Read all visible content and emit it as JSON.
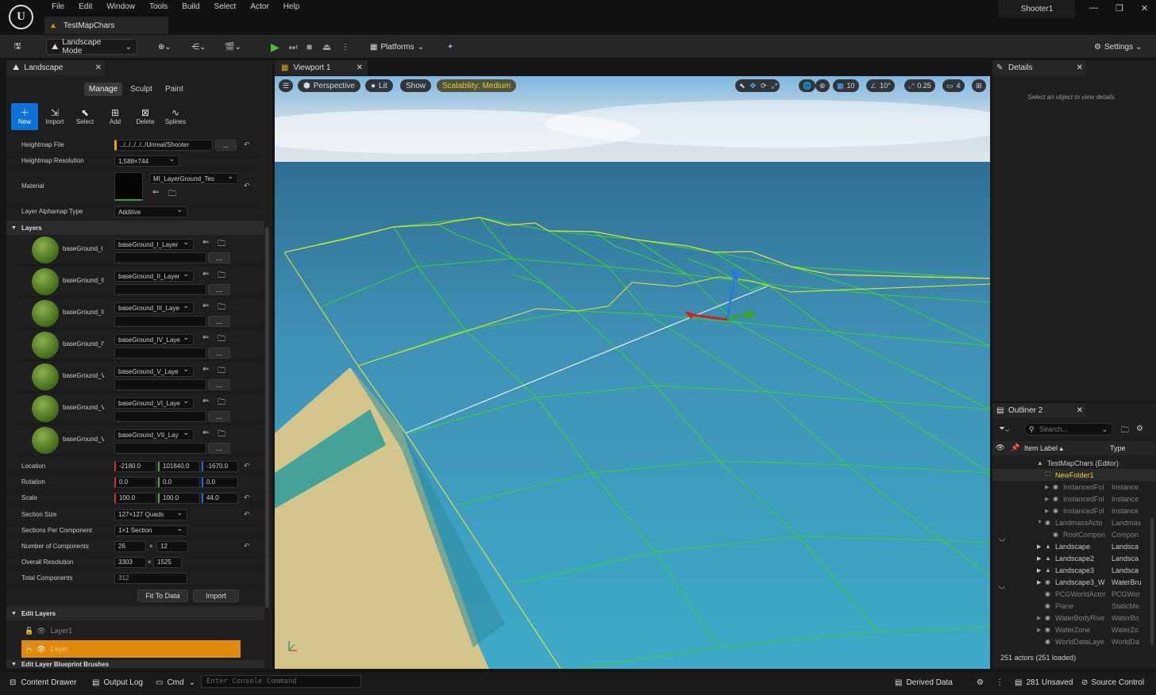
{
  "app": {
    "logo": "U",
    "menu": [
      "File",
      "Edit",
      "Window",
      "Tools",
      "Build",
      "Select",
      "Actor",
      "Help"
    ],
    "map_tab": "TestMapChars",
    "project": "Shooter1"
  },
  "toolbar": {
    "mode": "Landscape Mode",
    "platforms": "Platforms",
    "settings": "Settings"
  },
  "landscape": {
    "tab": "Landscape",
    "modes": [
      "Manage",
      "Sculpt",
      "Paint"
    ],
    "tools": [
      {
        "label": "New",
        "icon": "plus-icon"
      },
      {
        "label": "Import",
        "icon": "import-icon"
      },
      {
        "label": "Select",
        "icon": "select-icon"
      },
      {
        "label": "Add",
        "icon": "add-icon"
      },
      {
        "label": "Delete",
        "icon": "delete-icon"
      },
      {
        "label": "Splines",
        "icon": "splines-icon"
      }
    ],
    "heightmap_file_label": "Heightmap File",
    "heightmap_file": "../../../../../Unreal/Shooter",
    "heightmap_res_label": "Heightmap Resolution",
    "heightmap_res": "1,588×744",
    "material_label": "Material",
    "material": "MI_LayerGround_Tes",
    "alphamap_label": "Layer Alphamap Type",
    "alphamap": "Additive",
    "layers_header": "Layers",
    "layers": [
      {
        "name": "baseGround_I",
        "asset": "baseGround_I_Layer"
      },
      {
        "name": "baseGround_II",
        "asset": "baseGround_II_Layer"
      },
      {
        "name": "baseGround_II",
        "asset": "baseGround_III_Laye"
      },
      {
        "name": "baseGround_IV",
        "asset": "baseGround_IV_Laye"
      },
      {
        "name": "baseGround_V",
        "asset": "baseGround_V_Laye"
      },
      {
        "name": "baseGround_V",
        "asset": "baseGround_VI_Laye"
      },
      {
        "name": "baseGround_V",
        "asset": "baseGround_VII_Lay"
      }
    ],
    "location_label": "Location",
    "location": [
      "-2180.0",
      "101840.0",
      "-1670.0"
    ],
    "rotation_label": "Rotation",
    "rotation": [
      "0.0",
      "0.0",
      "0.0"
    ],
    "scale_label": "Scale",
    "scale": [
      "100.0",
      "100.0",
      "44.0"
    ],
    "section_size_label": "Section Size",
    "section_size": "127×127 Quads",
    "spc_label": "Sections Per Component",
    "spc": "1×1 Section",
    "ncomp_label": "Number of Components",
    "ncomp": [
      "26",
      "12"
    ],
    "ores_label": "Overall Resolution",
    "ores": [
      "3303",
      "1525"
    ],
    "total_label": "Total Components",
    "total": "312",
    "fit_btn": "Fit To Data",
    "import_btn": "Import",
    "edit_layers_header": "Edit Layers",
    "edit_layers": [
      "Layer1",
      "Layer"
    ],
    "blueprint_header": "Edit Layer Blueprint Brushes",
    "browse": "...",
    "times": "×"
  },
  "viewport": {
    "tab": "Viewport 1",
    "perspective": "Perspective",
    "lit": "Lit",
    "show": "Show",
    "scalability": "Scalability: Medium",
    "grid": "10",
    "angle": "10°",
    "scale": "0.25",
    "camera": "4"
  },
  "details": {
    "tab": "Details",
    "empty": "Select an object to view details."
  },
  "outliner": {
    "tab": "Outliner 2",
    "search_placeholder": "Search...",
    "col_label": "Item Label ▴",
    "col_type": "Type",
    "rows": [
      {
        "name": "TestMapChars (Editor)",
        "type": "",
        "indent": 0,
        "dim": false
      },
      {
        "name": "NewFolder1",
        "type": "",
        "indent": 1,
        "dim": false
      },
      {
        "name": "InstancedFol",
        "type": "Instance",
        "indent": 2,
        "dim": true
      },
      {
        "name": "InstancedFol",
        "type": "Instance",
        "indent": 2,
        "dim": true
      },
      {
        "name": "InstancedFol",
        "type": "Instance",
        "indent": 2,
        "dim": true
      },
      {
        "name": "LandmassActo",
        "type": "Landmas",
        "indent": 1,
        "dim": true
      },
      {
        "name": "RootCompon",
        "type": "Compon",
        "indent": 2,
        "dim": true
      },
      {
        "name": "Landscape",
        "type": "Landsca",
        "indent": 1,
        "dim": false
      },
      {
        "name": "Landscape2",
        "type": "Landsca",
        "indent": 1,
        "dim": false
      },
      {
        "name": "Landscape3",
        "type": "Landsca",
        "indent": 1,
        "dim": false
      },
      {
        "name": "Landscape3_W",
        "type": "WaterBru",
        "indent": 1,
        "dim": false
      },
      {
        "name": "PCGWorldActor",
        "type": "PCGWor",
        "indent": 1,
        "dim": true
      },
      {
        "name": "Plane",
        "type": "StaticMe",
        "indent": 1,
        "dim": true
      },
      {
        "name": "WaterBodyRive",
        "type": "WaterBo",
        "indent": 1,
        "dim": true
      },
      {
        "name": "WaterZone",
        "type": "WaterZo",
        "indent": 1,
        "dim": true
      },
      {
        "name": "WorldDataLaye",
        "type": "WorldDa",
        "indent": 1,
        "dim": true
      }
    ],
    "actors": "251 actors (251 loaded)"
  },
  "status": {
    "content_drawer": "Content Drawer",
    "output_log": "Output Log",
    "cmd": "Cmd",
    "console_placeholder": "Enter Console Command",
    "derived": "Derived Data",
    "unsaved": "281 Unsaved",
    "source": "Source Control"
  }
}
